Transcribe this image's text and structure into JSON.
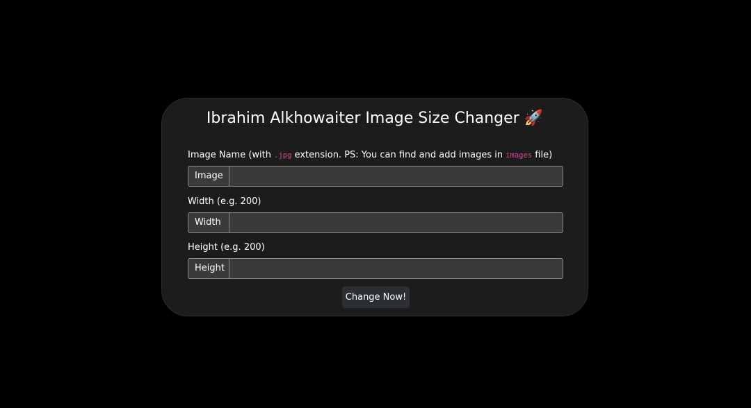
{
  "app": {
    "title": "Ibrahim Alkhowaiter Image Size Changer 🚀"
  },
  "form": {
    "image": {
      "label_prefix": "Image Name (with ",
      "label_code_ext": ".jpg",
      "label_middle": " extension. PS: You can find and add images in ",
      "label_code_folder": "images",
      "label_suffix": " file)",
      "addon": "Image",
      "value": "",
      "placeholder": ""
    },
    "width": {
      "label": "Width (e.g. 200)",
      "addon": "Width",
      "value": "",
      "placeholder": ""
    },
    "height": {
      "label": "Height (e.g. 200)",
      "addon": "Height",
      "value": "",
      "placeholder": ""
    },
    "submit_label": "Change Now!"
  },
  "colors": {
    "background": "#000000",
    "card": "#1c1c1c",
    "input": "#3a3a3a",
    "input_border": "#8a8a8a",
    "button": "#2b2e33",
    "code_accent": "#e0489a"
  }
}
